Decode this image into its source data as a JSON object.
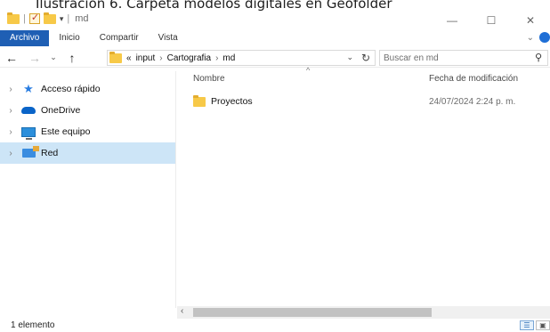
{
  "caption": "Ilustración 6. Carpeta modelos digitales en Geofolder",
  "window": {
    "title": "md",
    "minimize_glyph": "—",
    "maximize_glyph": "☐",
    "close_glyph": "✕"
  },
  "ribbon": {
    "tabs": [
      {
        "label": "Archivo",
        "active": true
      },
      {
        "label": "Inicio"
      },
      {
        "label": "Compartir"
      },
      {
        "label": "Vista"
      }
    ]
  },
  "address": {
    "overflow": "«",
    "crumbs": [
      "input",
      "Cartografia",
      "md"
    ],
    "separator": "›"
  },
  "search": {
    "placeholder": "Buscar en md"
  },
  "sidebar": {
    "items": [
      {
        "label": "Acceso rápido",
        "icon": "quick-access-star-icon"
      },
      {
        "label": "OneDrive",
        "icon": "onedrive-cloud-icon"
      },
      {
        "label": "Este equipo",
        "icon": "this-pc-icon"
      },
      {
        "label": "Red",
        "icon": "network-icon",
        "selected": true
      }
    ]
  },
  "columns": {
    "name": "Nombre",
    "date": "Fecha de modificación"
  },
  "files": [
    {
      "name": "Proyectos",
      "modified": "24/07/2024 2:24 p. m.",
      "type": "folder"
    }
  ],
  "status": {
    "count": "1 elemento"
  }
}
